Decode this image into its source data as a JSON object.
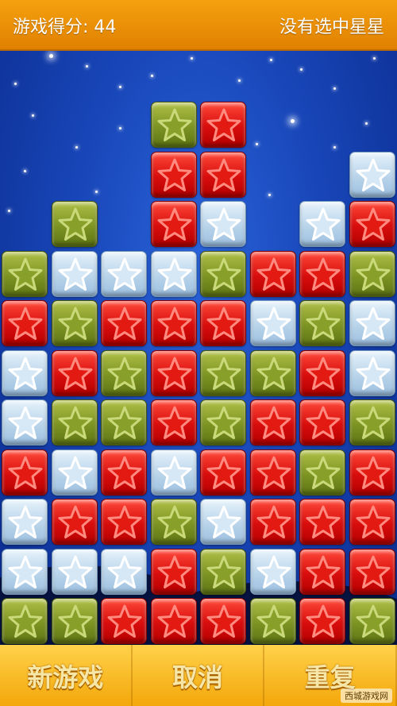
{
  "header": {
    "score_label": "游戏得分: 44",
    "status_text": "没有选中星星"
  },
  "controls": {
    "new_game": "新游戏",
    "cancel": "取消",
    "repeat": "重复"
  },
  "watermark": "西城游戏网",
  "colors": {
    "red": "#d80d0d",
    "green": "#7d9423",
    "blue": "#b9d4ea",
    "topbar": "#f39a08",
    "bottombar": "#f8c233"
  },
  "tile_icon": "star-icon",
  "grid_rows": [
    "...GR...",
    "...RR..B",
    ".G.RB.BR",
    "GBBBGRRG",
    "RGRRRBGB",
    "BRGRGGRB",
    "BGGRGRRG",
    "RBRBRRGR",
    "BRRGBRRR",
    "BBBRGBRR",
    "GGRRRGRG"
  ]
}
